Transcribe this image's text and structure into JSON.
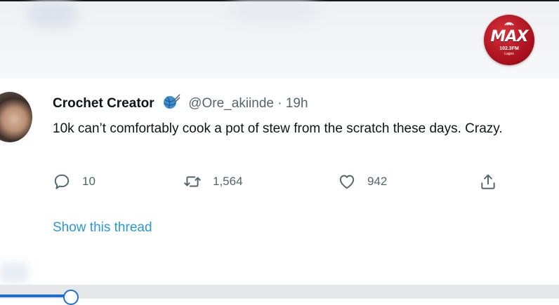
{
  "brand": {
    "logo_text": "MAX",
    "frequency": "102.3FM",
    "city": "Lagos",
    "accent_color": "#b0121d"
  },
  "tweet": {
    "author_name": "Crochet Creator",
    "badge_icon": "yarn-ball-icon",
    "handle": "@Ore_akiinde",
    "separator": "·",
    "time": "19h",
    "text": "10k can’t comfortably cook a pot of stew from the scratch these days. Crazy.",
    "replies": "10",
    "retweets": "1,564",
    "likes": "942",
    "show_thread": "Show this thread"
  },
  "icons": [
    "reply-icon",
    "retweet-icon",
    "like-icon",
    "share-icon"
  ],
  "colors": {
    "link": "#2a98d8",
    "muted": "#536471",
    "text": "#0f1419"
  }
}
